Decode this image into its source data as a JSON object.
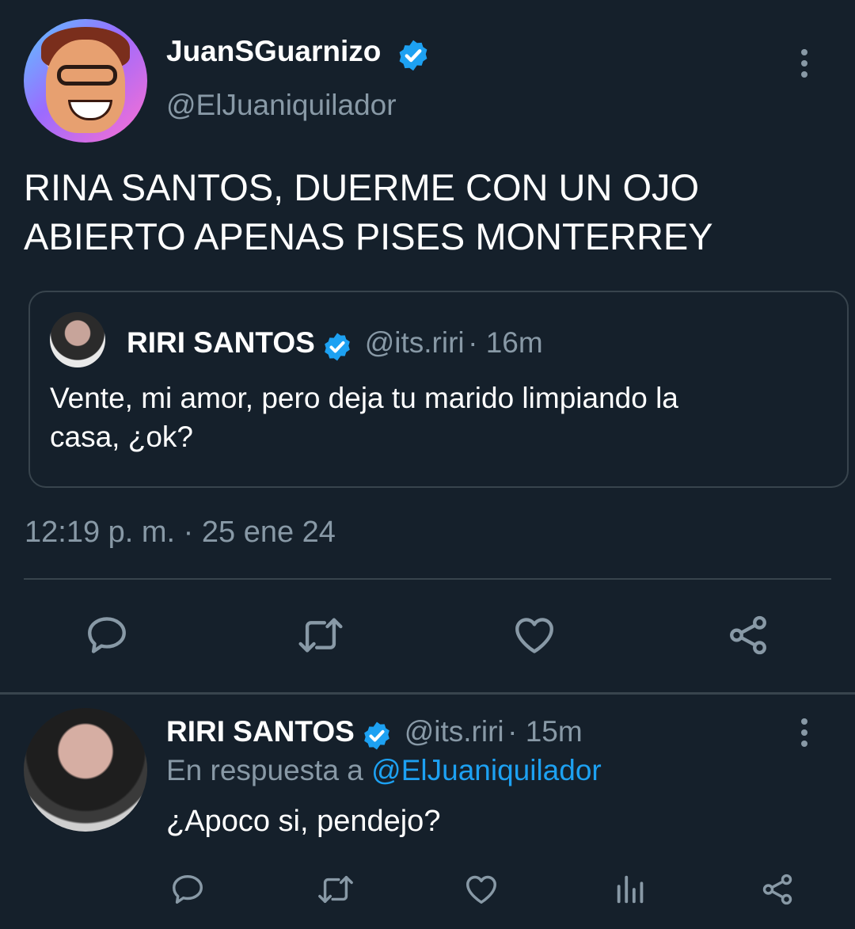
{
  "main_tweet": {
    "display_name": "JuanSGuarnizo",
    "handle": "@ElJuaniquilador",
    "text_line1": "RINA SANTOS, DUERME CON UN OJO",
    "text_line2": "ABIERTO APENAS PISES MONTERREY",
    "timestamp": "12:19 p. m. · 25 ene 24"
  },
  "quoted_tweet": {
    "display_name": "RIRI SANTOS",
    "handle": "@its.riri",
    "time": "· 16m",
    "text_line1": "Vente, mi amor, pero deja tu marido limpiando la",
    "text_line2": "casa, ¿ok?"
  },
  "reply_tweet": {
    "display_name": "RIRI SANTOS",
    "handle": "@its.riri",
    "time": "· 15m",
    "reply_prefix": "En respuesta a",
    "reply_to": "@ElJuaniquilador",
    "text": "¿Apoco si, pendejo?"
  },
  "icons": [
    "verified-icon",
    "more-icon",
    "reply-icon",
    "retweet-icon",
    "like-icon",
    "share-icon",
    "analytics-icon"
  ],
  "colors": {
    "background": "#15202b",
    "accent": "#1da1f2",
    "secondary_text": "#8899a6",
    "border": "#38444d"
  }
}
